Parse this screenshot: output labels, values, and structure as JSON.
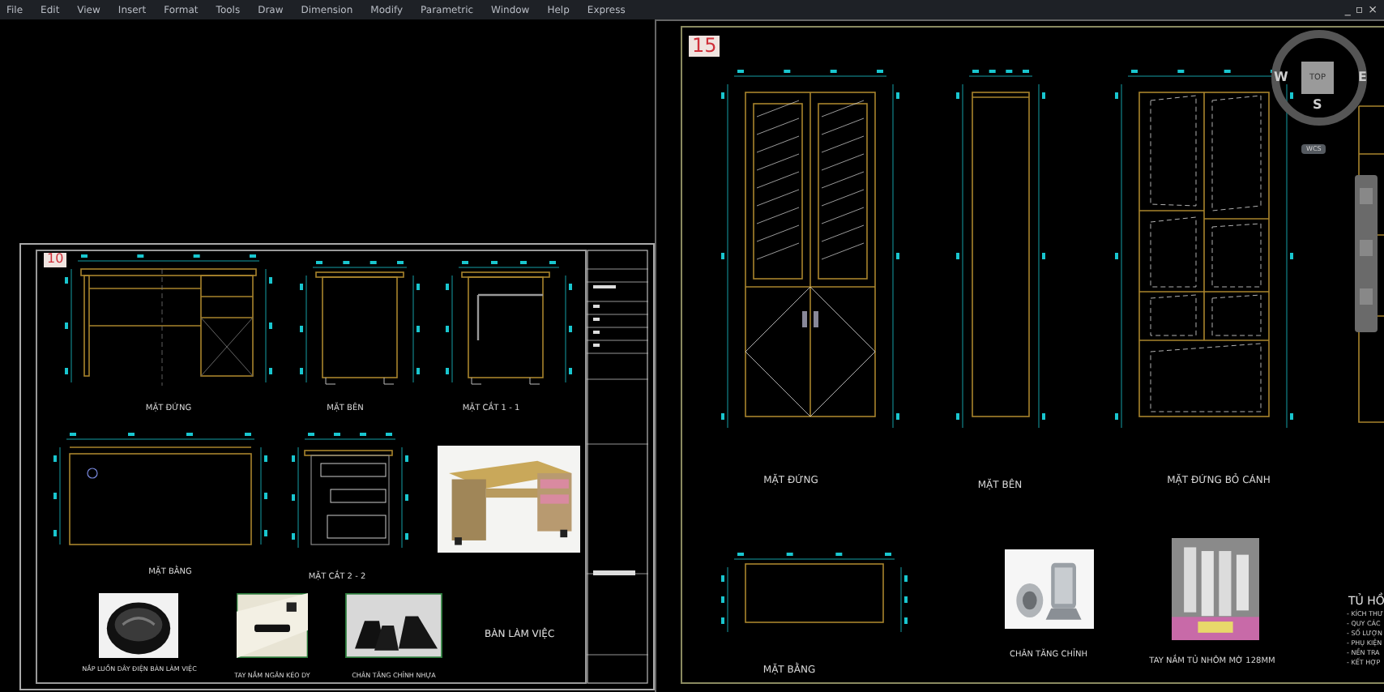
{
  "menu": [
    "File",
    "Edit",
    "View",
    "Insert",
    "Format",
    "Tools",
    "Draw",
    "Dimension",
    "Modify",
    "Parametric",
    "Window",
    "Help",
    "Express"
  ],
  "window_controls": [
    "_",
    "▫",
    "×"
  ],
  "left_sheet": {
    "number": "10",
    "title": "BÀN LÀM VIỆC",
    "views": [
      {
        "kind": "desk-front",
        "label": "MẶT ĐỨNG"
      },
      {
        "kind": "desk-side",
        "label": "MẶT BÊN"
      },
      {
        "kind": "desk-section-a",
        "label": "MẶT CẮT 1 - 1"
      },
      {
        "kind": "desk-plan",
        "label": "MẶT BẰNG"
      },
      {
        "kind": "desk-section-b",
        "label": "MẶT CẮT 2 - 2"
      }
    ],
    "photos": [
      {
        "kind": "desk"
      },
      {
        "kind": "grommet",
        "caption": "NẮP LUỒN DÂY ĐIỆN BÀN LÀM VIỆC"
      },
      {
        "kind": "handle",
        "caption": "TAY NẮM NGĂN KÉO DY"
      },
      {
        "kind": "feet",
        "caption": "CHÂN TĂNG CHỈNH NHỰA"
      }
    ]
  },
  "right_sheet": {
    "number": "15",
    "views": [
      {
        "kind": "cabinet-front",
        "label": "MẶT ĐỨNG"
      },
      {
        "kind": "cabinet-side",
        "label": "MẶT BÊN"
      },
      {
        "kind": "cabinet-open",
        "label": "MẶT ĐỨNG BỎ CÁNH"
      },
      {
        "kind": "cabinet-plan",
        "label": "MẶT BẰNG"
      }
    ],
    "photos": [
      {
        "kind": "foot",
        "caption": "CHÂN TĂNG CHỈNH"
      },
      {
        "kind": "handles",
        "caption": "TAY NẮM TỦ  NHÔM MỜ 128MM"
      }
    ],
    "notes": {
      "title": "TỦ HỒ",
      "lines": [
        "- KÍCH THƯ",
        "- QUY CÁC",
        "- SỐ LƯỢN",
        "- PHỤ KIỆN",
        "- NỀN TRA",
        "- KẾT HỢP"
      ]
    }
  },
  "viewcube": {
    "top": "TOP",
    "directions": [
      "W",
      "E",
      "S"
    ],
    "ucs": "WCS"
  }
}
